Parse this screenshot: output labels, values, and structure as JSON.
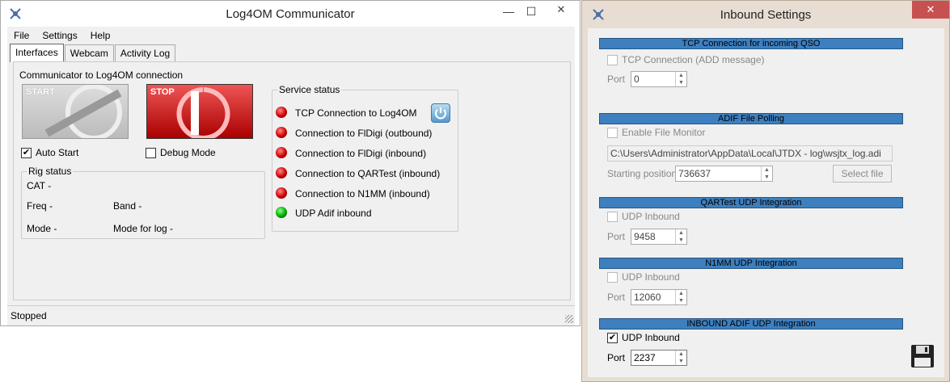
{
  "communicator": {
    "title": "Log4OM Communicator",
    "menu": [
      "File",
      "Settings",
      "Help"
    ],
    "tabs": [
      "Interfaces",
      "Webcam",
      "Activity Log"
    ],
    "connection_legend": "Communicator to Log4OM connection",
    "start_label": "START",
    "stop_label": "STOP",
    "auto_start": {
      "label": "Auto Start",
      "checked": true
    },
    "debug_mode": {
      "label": "Debug Mode",
      "checked": false
    },
    "rig_status": {
      "legend": "Rig status",
      "cat": "CAT  -",
      "freq": "Freq  -",
      "band": "Band  -",
      "mode": "Mode  -",
      "mode_for_log": "Mode for log  -"
    },
    "service_status": {
      "legend": "Service status",
      "items": [
        {
          "label": "TCP Connection to Log4OM",
          "state": "red"
        },
        {
          "label": "Connection to FlDigi (outbound)",
          "state": "red"
        },
        {
          "label": "Connection to FlDigi (inbound)",
          "state": "red"
        },
        {
          "label": "Connection to QARTest (inbound)",
          "state": "red"
        },
        {
          "label": "Connection to N1MM (inbound)",
          "state": "red"
        },
        {
          "label": "UDP Adif inbound",
          "state": "green"
        }
      ]
    },
    "status": "Stopped",
    "close_glyph": "✕",
    "minimize_glyph": "—",
    "maximize_glyph": "☐"
  },
  "inbound": {
    "title": "Inbound Settings",
    "close_glyph": "✕",
    "tcp": {
      "header": "TCP Connection for incoming QSO",
      "checkbox": "TCP Connection (ADD message)",
      "port_label": "Port",
      "port": "0"
    },
    "adif_poll": {
      "header": "ADIF File Polling",
      "checkbox": "Enable File Monitor",
      "path": "C:\\Users\\Administrator\\AppData\\Local\\JTDX - log\\wsjtx_log.adi",
      "start_label": "Starting position",
      "start_value": "736637",
      "select_file": "Select file"
    },
    "qartest": {
      "header": "QARTest UDP Integration",
      "checkbox": "UDP Inbound",
      "port_label": "Port",
      "port": "9458"
    },
    "n1mm": {
      "header": "N1MM UDP Integration",
      "checkbox": "UDP Inbound",
      "port_label": "Port",
      "port": "12060"
    },
    "adif_udp": {
      "header": "INBOUND ADIF UDP Integration",
      "checkbox": "UDP Inbound",
      "checked": true,
      "port_label": "Port",
      "port": "2237"
    },
    "accent": "#3d7fbf"
  }
}
